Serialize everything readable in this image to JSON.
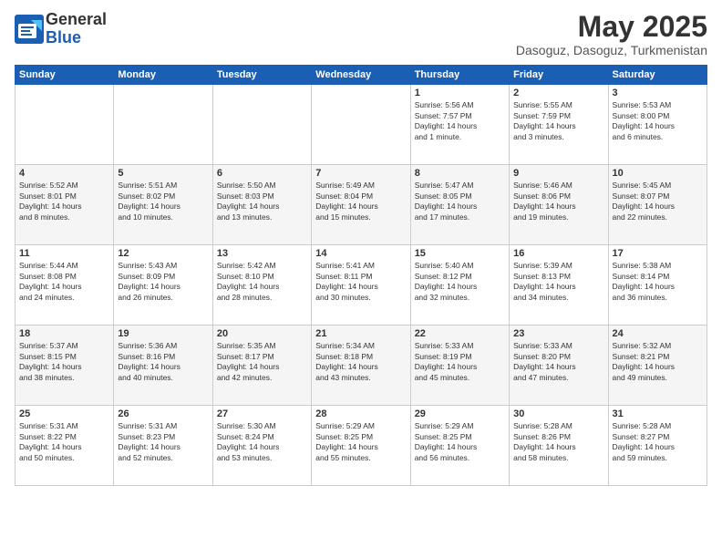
{
  "logo": {
    "general": "General",
    "blue": "Blue"
  },
  "title": "May 2025",
  "subtitle": "Dasoguz, Dasoguz, Turkmenistan",
  "weekdays": [
    "Sunday",
    "Monday",
    "Tuesday",
    "Wednesday",
    "Thursday",
    "Friday",
    "Saturday"
  ],
  "weeks": [
    [
      {
        "day": "",
        "info": ""
      },
      {
        "day": "",
        "info": ""
      },
      {
        "day": "",
        "info": ""
      },
      {
        "day": "",
        "info": ""
      },
      {
        "day": "1",
        "info": "Sunrise: 5:56 AM\nSunset: 7:57 PM\nDaylight: 14 hours\nand 1 minute."
      },
      {
        "day": "2",
        "info": "Sunrise: 5:55 AM\nSunset: 7:59 PM\nDaylight: 14 hours\nand 3 minutes."
      },
      {
        "day": "3",
        "info": "Sunrise: 5:53 AM\nSunset: 8:00 PM\nDaylight: 14 hours\nand 6 minutes."
      }
    ],
    [
      {
        "day": "4",
        "info": "Sunrise: 5:52 AM\nSunset: 8:01 PM\nDaylight: 14 hours\nand 8 minutes."
      },
      {
        "day": "5",
        "info": "Sunrise: 5:51 AM\nSunset: 8:02 PM\nDaylight: 14 hours\nand 10 minutes."
      },
      {
        "day": "6",
        "info": "Sunrise: 5:50 AM\nSunset: 8:03 PM\nDaylight: 14 hours\nand 13 minutes."
      },
      {
        "day": "7",
        "info": "Sunrise: 5:49 AM\nSunset: 8:04 PM\nDaylight: 14 hours\nand 15 minutes."
      },
      {
        "day": "8",
        "info": "Sunrise: 5:47 AM\nSunset: 8:05 PM\nDaylight: 14 hours\nand 17 minutes."
      },
      {
        "day": "9",
        "info": "Sunrise: 5:46 AM\nSunset: 8:06 PM\nDaylight: 14 hours\nand 19 minutes."
      },
      {
        "day": "10",
        "info": "Sunrise: 5:45 AM\nSunset: 8:07 PM\nDaylight: 14 hours\nand 22 minutes."
      }
    ],
    [
      {
        "day": "11",
        "info": "Sunrise: 5:44 AM\nSunset: 8:08 PM\nDaylight: 14 hours\nand 24 minutes."
      },
      {
        "day": "12",
        "info": "Sunrise: 5:43 AM\nSunset: 8:09 PM\nDaylight: 14 hours\nand 26 minutes."
      },
      {
        "day": "13",
        "info": "Sunrise: 5:42 AM\nSunset: 8:10 PM\nDaylight: 14 hours\nand 28 minutes."
      },
      {
        "day": "14",
        "info": "Sunrise: 5:41 AM\nSunset: 8:11 PM\nDaylight: 14 hours\nand 30 minutes."
      },
      {
        "day": "15",
        "info": "Sunrise: 5:40 AM\nSunset: 8:12 PM\nDaylight: 14 hours\nand 32 minutes."
      },
      {
        "day": "16",
        "info": "Sunrise: 5:39 AM\nSunset: 8:13 PM\nDaylight: 14 hours\nand 34 minutes."
      },
      {
        "day": "17",
        "info": "Sunrise: 5:38 AM\nSunset: 8:14 PM\nDaylight: 14 hours\nand 36 minutes."
      }
    ],
    [
      {
        "day": "18",
        "info": "Sunrise: 5:37 AM\nSunset: 8:15 PM\nDaylight: 14 hours\nand 38 minutes."
      },
      {
        "day": "19",
        "info": "Sunrise: 5:36 AM\nSunset: 8:16 PM\nDaylight: 14 hours\nand 40 minutes."
      },
      {
        "day": "20",
        "info": "Sunrise: 5:35 AM\nSunset: 8:17 PM\nDaylight: 14 hours\nand 42 minutes."
      },
      {
        "day": "21",
        "info": "Sunrise: 5:34 AM\nSunset: 8:18 PM\nDaylight: 14 hours\nand 43 minutes."
      },
      {
        "day": "22",
        "info": "Sunrise: 5:33 AM\nSunset: 8:19 PM\nDaylight: 14 hours\nand 45 minutes."
      },
      {
        "day": "23",
        "info": "Sunrise: 5:33 AM\nSunset: 8:20 PM\nDaylight: 14 hours\nand 47 minutes."
      },
      {
        "day": "24",
        "info": "Sunrise: 5:32 AM\nSunset: 8:21 PM\nDaylight: 14 hours\nand 49 minutes."
      }
    ],
    [
      {
        "day": "25",
        "info": "Sunrise: 5:31 AM\nSunset: 8:22 PM\nDaylight: 14 hours\nand 50 minutes."
      },
      {
        "day": "26",
        "info": "Sunrise: 5:31 AM\nSunset: 8:23 PM\nDaylight: 14 hours\nand 52 minutes."
      },
      {
        "day": "27",
        "info": "Sunrise: 5:30 AM\nSunset: 8:24 PM\nDaylight: 14 hours\nand 53 minutes."
      },
      {
        "day": "28",
        "info": "Sunrise: 5:29 AM\nSunset: 8:25 PM\nDaylight: 14 hours\nand 55 minutes."
      },
      {
        "day": "29",
        "info": "Sunrise: 5:29 AM\nSunset: 8:25 PM\nDaylight: 14 hours\nand 56 minutes."
      },
      {
        "day": "30",
        "info": "Sunrise: 5:28 AM\nSunset: 8:26 PM\nDaylight: 14 hours\nand 58 minutes."
      },
      {
        "day": "31",
        "info": "Sunrise: 5:28 AM\nSunset: 8:27 PM\nDaylight: 14 hours\nand 59 minutes."
      }
    ]
  ]
}
